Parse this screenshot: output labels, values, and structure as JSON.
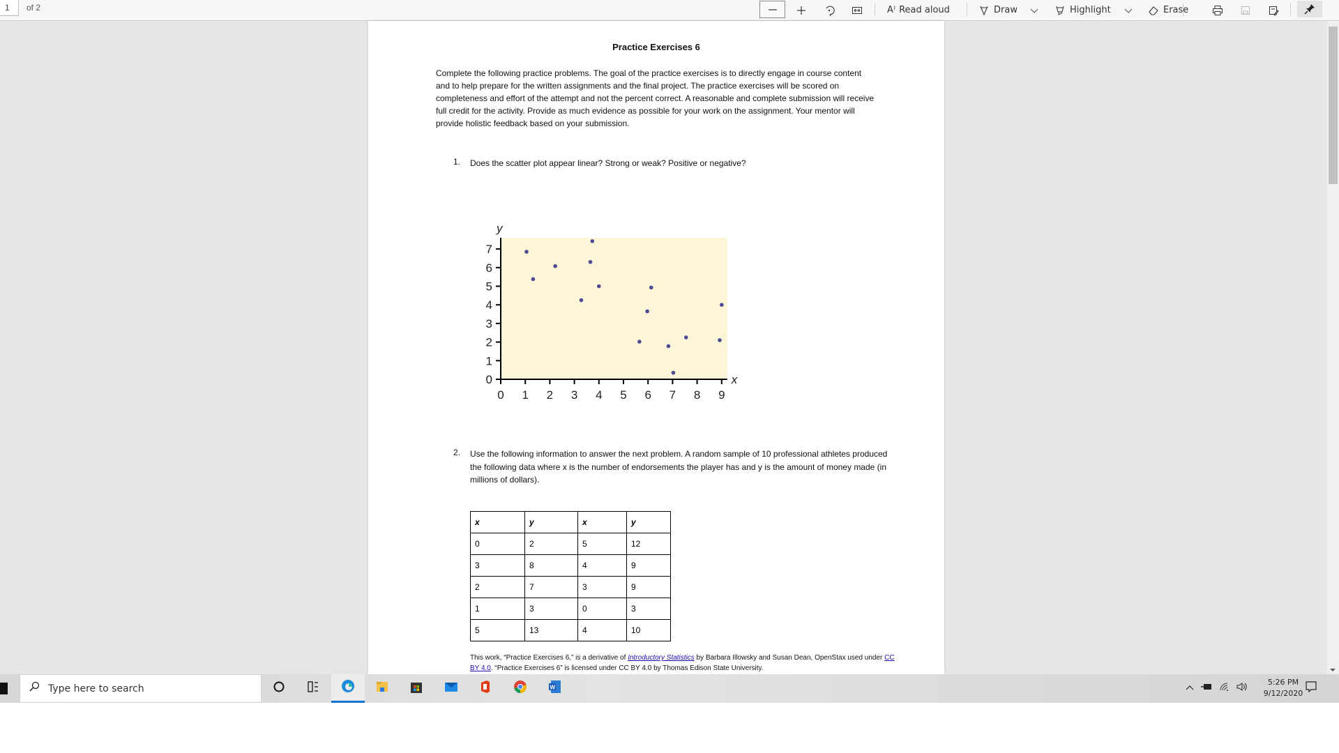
{
  "toolbar": {
    "page_current": "1",
    "page_total_label": "of 2",
    "zoom_out_icon": "minus-icon",
    "zoom_in_icon": "plus-icon",
    "rotate_icon": "rotate-icon",
    "fit_icon": "fit-width-icon",
    "read_aloud_label": "Read aloud",
    "draw_label": "Draw",
    "highlight_label": "Highlight",
    "erase_label": "Erase"
  },
  "document": {
    "title": "Practice Exercises 6",
    "intro": "Complete the following practice problems. The goal of the practice exercises is to directly engage in course content and to help prepare for the written assignments and the final project. The practice exercises will be scored on completeness and effort of the attempt and not the percent correct. A reasonable and complete submission will receive full credit for the activity. Provide as much evidence as possible for your work on the assignment. Your mentor will provide holistic feedback based on your submission.",
    "questions": [
      {
        "number": "1.",
        "text": "Does the scatter plot appear linear? Strong or weak? Positive or negative?"
      },
      {
        "number": "2.",
        "text": "Use the following information to answer the next problem. A random sample of 10 professional athletes produced the following data where x is the number of endorsements the player has and y is the amount of money made (in millions of dollars)."
      }
    ],
    "table": {
      "headers": [
        "x",
        "y",
        "x",
        "y"
      ],
      "rows": [
        [
          "0",
          "2",
          "5",
          "12"
        ],
        [
          "3",
          "8",
          "4",
          "9"
        ],
        [
          "2",
          "7",
          "3",
          "9"
        ],
        [
          "1",
          "3",
          "0",
          "3"
        ],
        [
          "5",
          "13",
          "4",
          "10"
        ]
      ]
    },
    "footer": {
      "part1": "This work, “Practice Exercises 6,” is a derivative of ",
      "link1": "Introductory Statistics",
      "part2": " by Barbara Illowsky and Susan Dean, OpenStax used under ",
      "link2": "CC BY 4.0",
      "part3": ". “Practice Exercises 6” is licensed under CC BY 4.0 by Thomas Edison State University."
    }
  },
  "chart_data": {
    "type": "scatter",
    "title": "",
    "xlabel": "x",
    "ylabel": "y",
    "xlim": [
      0,
      9
    ],
    "ylim": [
      0,
      7.6
    ],
    "xticks": [
      0,
      1,
      2,
      3,
      4,
      5,
      6,
      7,
      8,
      9
    ],
    "yticks": [
      0,
      1,
      2,
      3,
      4,
      5,
      6,
      7
    ],
    "grid": false,
    "background": "#fdf5d8",
    "point_color": "#4c4a93",
    "points": [
      {
        "x": 1.05,
        "y": 6.85
      },
      {
        "x": 1.32,
        "y": 5.38
      },
      {
        "x": 2.22,
        "y": 6.08
      },
      {
        "x": 3.28,
        "y": 4.25
      },
      {
        "x": 3.65,
        "y": 6.3
      },
      {
        "x": 3.73,
        "y": 7.42
      },
      {
        "x": 4.0,
        "y": 5.0
      },
      {
        "x": 5.65,
        "y": 2.02
      },
      {
        "x": 5.97,
        "y": 3.65
      },
      {
        "x": 6.13,
        "y": 4.93
      },
      {
        "x": 6.83,
        "y": 1.78
      },
      {
        "x": 7.03,
        "y": 0.35
      },
      {
        "x": 7.55,
        "y": 2.25
      },
      {
        "x": 8.92,
        "y": 2.1
      },
      {
        "x": 9.0,
        "y": 4.0
      }
    ]
  },
  "taskbar": {
    "search_placeholder": "Type here to search",
    "apps": [
      "cortana",
      "task-view",
      "edge",
      "file-explorer",
      "store",
      "mail",
      "office",
      "chrome",
      "word"
    ],
    "time": "5:26 PM",
    "date": "9/12/2020"
  }
}
